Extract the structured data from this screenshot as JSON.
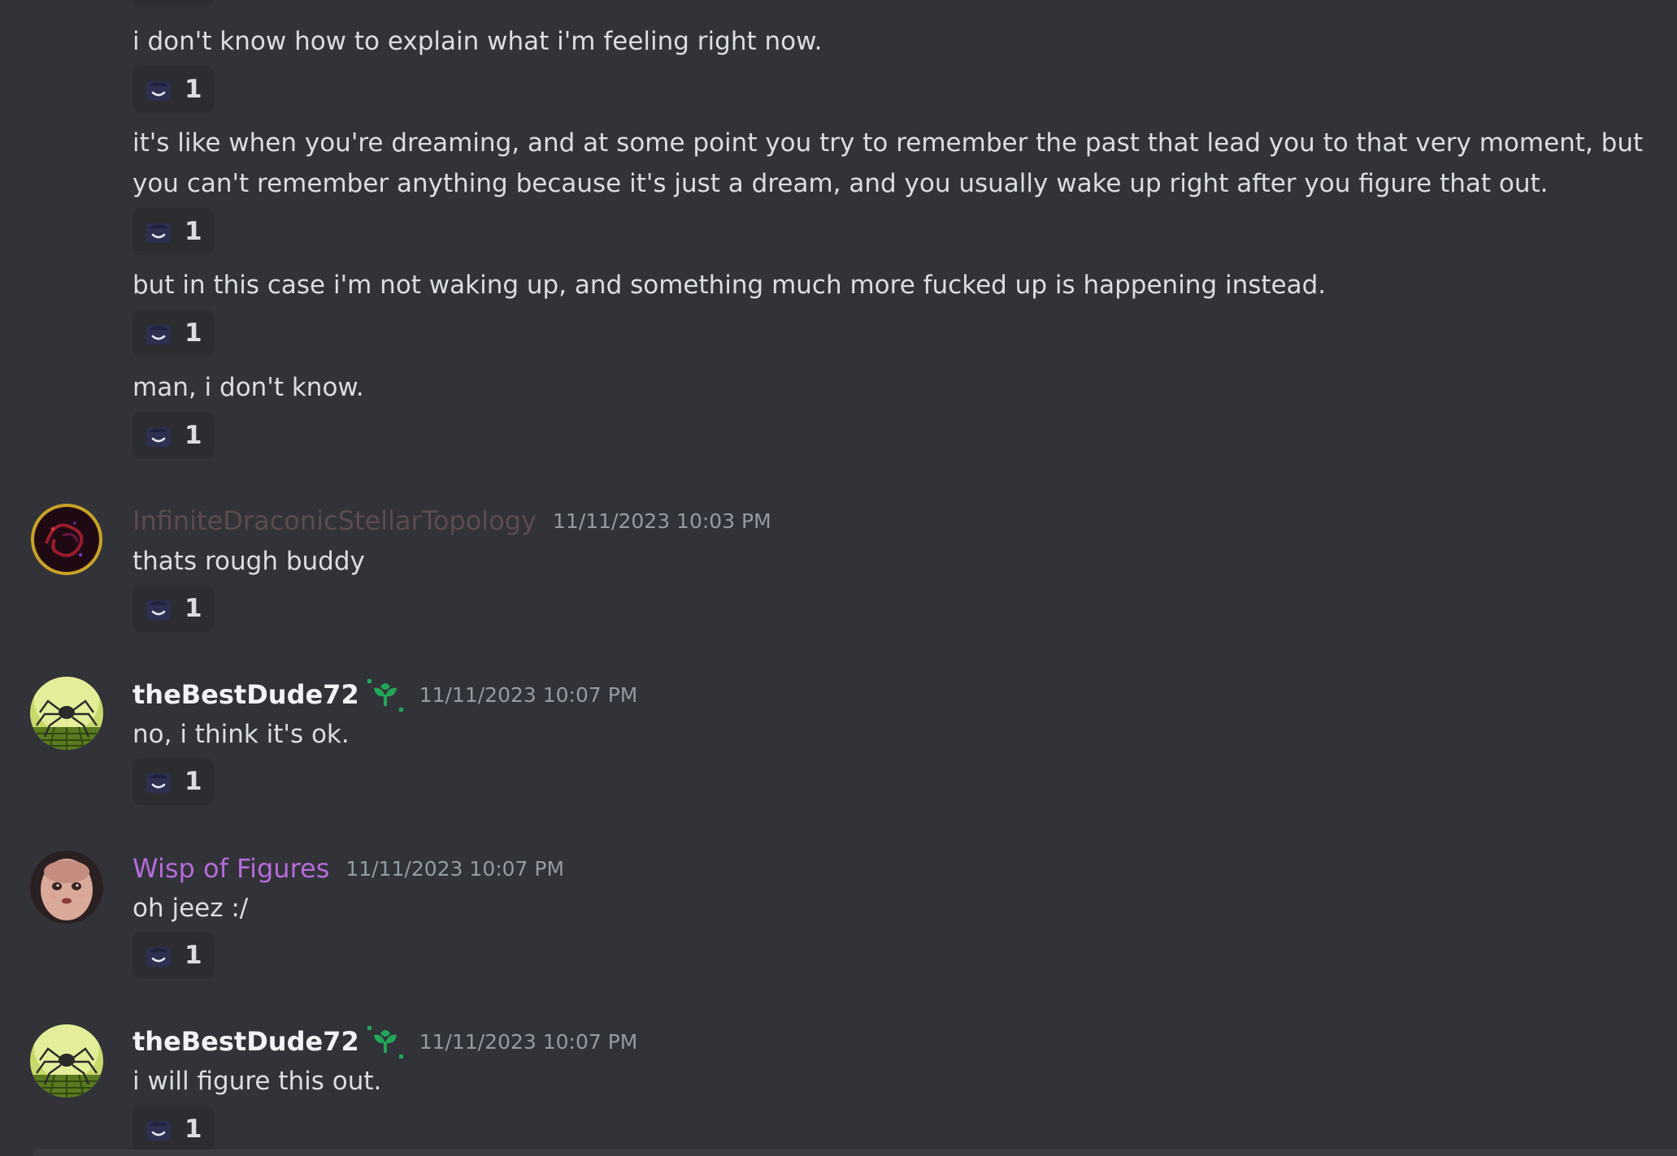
{
  "theme": {
    "background": "#313338",
    "message_text": "#dbdee1",
    "timestamp_color": "#949ba4",
    "reaction_background": "#2b2d31"
  },
  "reaction_emoji": "sleeping-face-emoji",
  "continued_messages": [
    {
      "text": "i don't know how to explain what i'm feeling right now.",
      "reaction_count": "1"
    },
    {
      "text": "it's like when you're dreaming, and at some point you try to remember the past that lead you to that very moment, but you can't remember anything because it's just a dream, and you usually wake up right after you figure that out.",
      "reaction_count": "1"
    },
    {
      "text": "but in this case i'm not waking up, and something much more fucked up is happening instead.",
      "reaction_count": "1"
    },
    {
      "text": "man, i don't know.",
      "reaction_count": "1"
    }
  ],
  "messages": [
    {
      "username": "InfiniteDraconicStellarTopology",
      "username_color": "#5d4b4f",
      "timestamp": "11/11/2023 10:03 PM",
      "text": "thats rough buddy",
      "reaction_count": "1",
      "avatar": "red-dragon-avatar"
    },
    {
      "username": "theBestDude72",
      "username_color": "#f2f3f5",
      "badge": "sprout-icon",
      "timestamp": "11/11/2023 10:07 PM",
      "text": "no, i think it's ok.",
      "reaction_count": "1",
      "avatar": "spider-maze-avatar"
    },
    {
      "username": "Wisp of Figures",
      "username_color": "#b66bdb",
      "timestamp": "11/11/2023 10:07 PM",
      "text": "oh jeez :/",
      "reaction_count": "1",
      "avatar": "doll-face-avatar"
    },
    {
      "username": "theBestDude72",
      "username_color": "#f2f3f5",
      "badge": "sprout-icon",
      "timestamp": "11/11/2023 10:07 PM",
      "text": "i will figure this out.",
      "reaction_count": "1",
      "avatar": "spider-maze-avatar"
    }
  ]
}
